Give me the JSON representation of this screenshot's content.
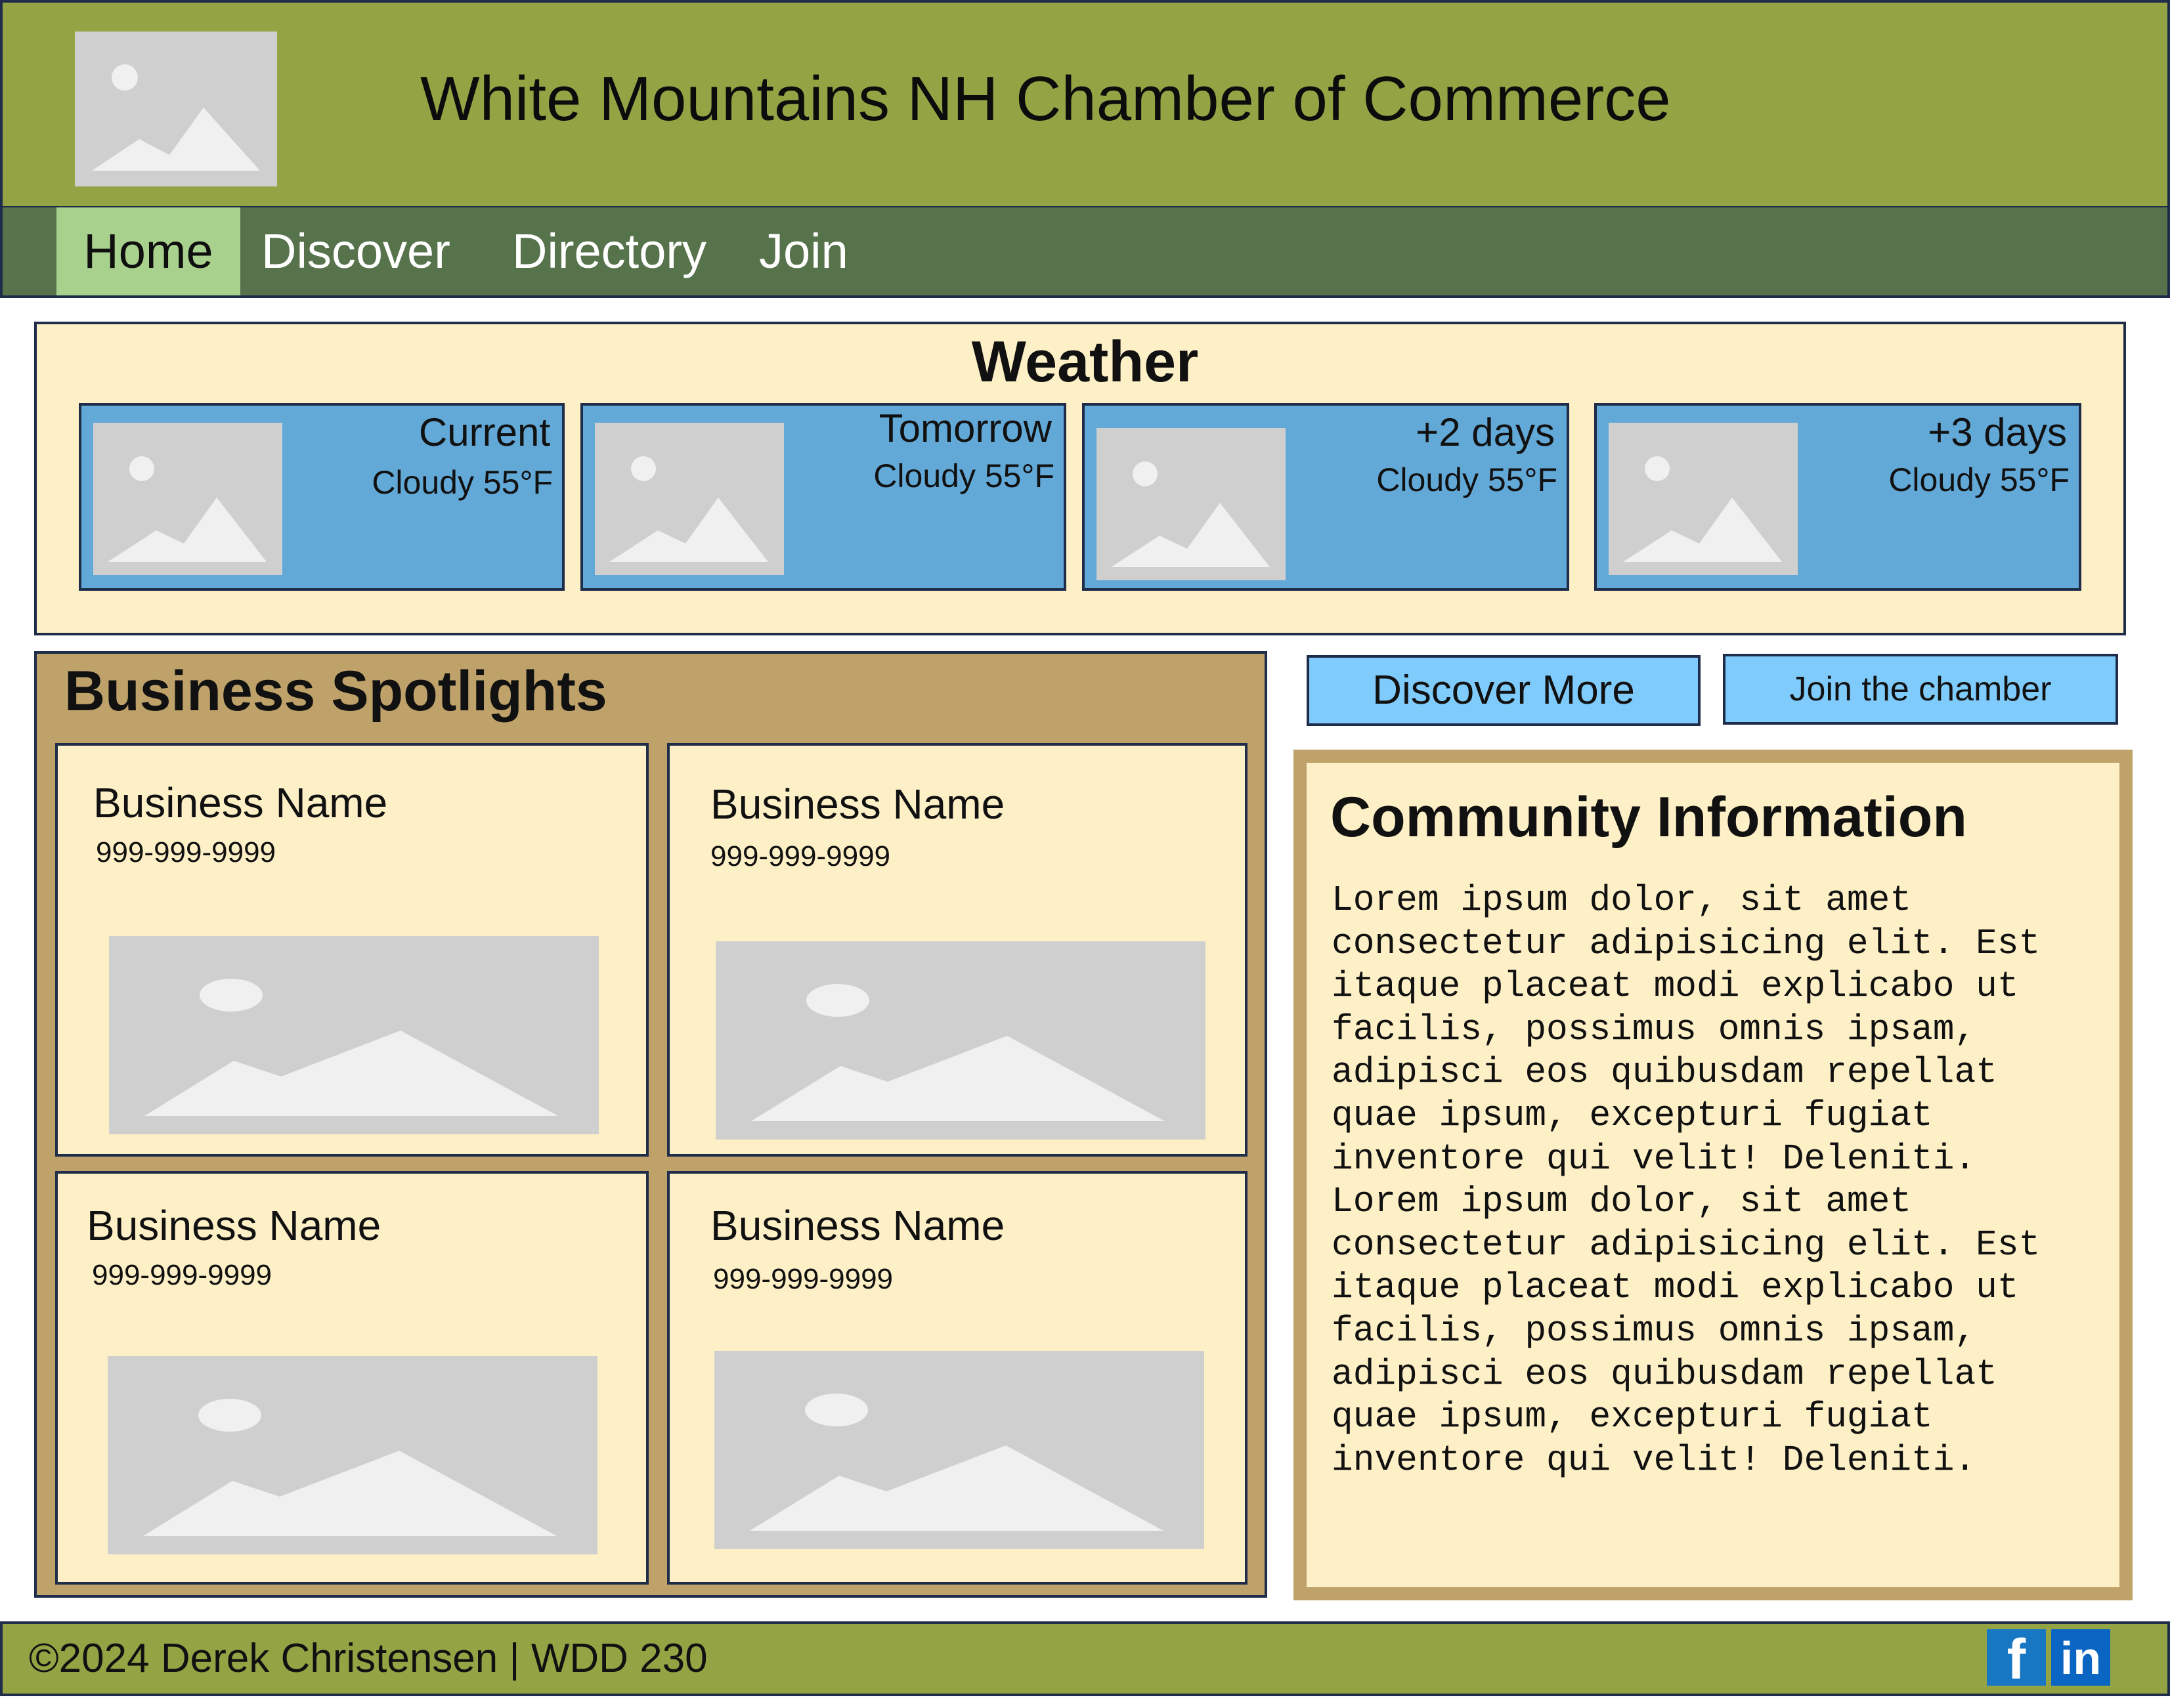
{
  "header": {
    "title": "White Mountains NH Chamber of Commerce",
    "logo_icon": "image-placeholder-icon"
  },
  "nav": {
    "items": [
      {
        "label": "Home",
        "active": true
      },
      {
        "label": "Discover"
      },
      {
        "label": "Directory"
      },
      {
        "label": "Join"
      }
    ]
  },
  "weather": {
    "title": "Weather",
    "cards": [
      {
        "day": "Current",
        "condition": "Cloudy 55°F"
      },
      {
        "day": "Tomorrow",
        "condition": "Cloudy 55°F"
      },
      {
        "day": "+2 days",
        "condition": "Cloudy 55°F"
      },
      {
        "day": "+3 days",
        "condition": "Cloudy 55°F"
      }
    ]
  },
  "spotlights": {
    "title": "Business Spotlights",
    "businesses": [
      {
        "name": "Business Name",
        "phone": "999-999-9999"
      },
      {
        "name": "Business Name",
        "phone": "999-999-9999"
      },
      {
        "name": "Business Name",
        "phone": "999-999-9999"
      },
      {
        "name": "Business Name",
        "phone": "999-999-9999"
      }
    ]
  },
  "actions": {
    "discover_label": "Discover More",
    "join_label": "Join the chamber"
  },
  "community": {
    "title": "Community Information",
    "body": "Lorem ipsum dolor, sit amet\nconsectetur adipisicing elit. Est\nitaque placeat modi explicabo ut\nfacilis, possimus omnis ipsam,\nadipisci eos quibusdam repellat\nquae ipsum, excepturi fugiat\ninventore qui velit! Deleniti.\nLorem ipsum dolor, sit amet\nconsectetur adipisicing elit. Est\nitaque placeat modi explicabo ut\nfacilis, possimus omnis ipsam,\nadipisci eos quibusdam repellat\nquae ipsum, excepturi fugiat\ninventore qui velit! Deleniti."
  },
  "footer": {
    "text": "©2024 Derek Christensen | WDD 230",
    "social": [
      "facebook-icon",
      "linkedin-icon"
    ]
  },
  "colors": {
    "header": "#94a444",
    "nav": "#57734c",
    "nav_active": "#a9d18e",
    "panel": "#fef0c6",
    "weather_card": "#62a9d8",
    "spotlight": "#bfa26a",
    "button": "#7fcbfc"
  }
}
